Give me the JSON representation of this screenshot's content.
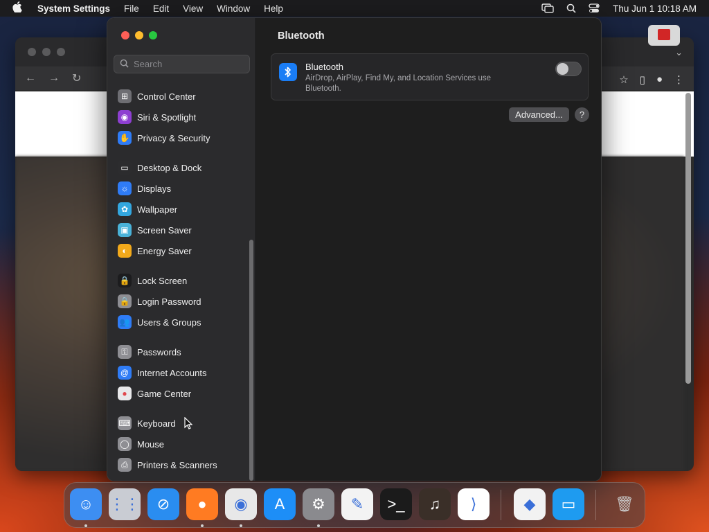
{
  "menubar": {
    "app_name": "System Settings",
    "menus": [
      "File",
      "Edit",
      "View",
      "Window",
      "Help"
    ],
    "clock": "Thu Jun 1  10:18 AM"
  },
  "window": {
    "search_placeholder": "Search",
    "sidebar_items": [
      {
        "label": "Control Center",
        "icon": "control-center-icon",
        "color": "#6e6e73"
      },
      {
        "label": "Siri & Spotlight",
        "icon": "siri-icon",
        "color": "#8e3fd1"
      },
      {
        "label": "Privacy & Security",
        "icon": "hand-icon",
        "color": "#2f7cf6"
      },
      {
        "label": "Desktop & Dock",
        "icon": "desktop-dock-icon",
        "color": "#2c2c2e"
      },
      {
        "label": "Displays",
        "icon": "sun-icon",
        "color": "#2f7cf6"
      },
      {
        "label": "Wallpaper",
        "icon": "flower-icon",
        "color": "#33a7e0"
      },
      {
        "label": "Screen Saver",
        "icon": "screensaver-icon",
        "color": "#4ab2d8"
      },
      {
        "label": "Energy Saver",
        "icon": "bulb-icon",
        "color": "#f2a91b"
      },
      {
        "label": "Lock Screen",
        "icon": "lock-icon",
        "color": "#1c1c1e"
      },
      {
        "label": "Login Password",
        "icon": "lock-small-icon",
        "color": "#8e8e93"
      },
      {
        "label": "Users & Groups",
        "icon": "users-icon",
        "color": "#2f7cf6"
      },
      {
        "label": "Passwords",
        "icon": "key-icon",
        "color": "#8e8e93"
      },
      {
        "label": "Internet Accounts",
        "icon": "at-icon",
        "color": "#2f7cf6"
      },
      {
        "label": "Game Center",
        "icon": "game-center-icon",
        "color": "#e8e8ea"
      },
      {
        "label": "Keyboard",
        "icon": "keyboard-icon",
        "color": "#8e8e93"
      },
      {
        "label": "Mouse",
        "icon": "mouse-icon",
        "color": "#8e8e93"
      },
      {
        "label": "Printers & Scanners",
        "icon": "printer-icon",
        "color": "#8e8e93"
      }
    ],
    "main": {
      "title": "Bluetooth",
      "card_title": "Bluetooth",
      "card_desc": "AirDrop, AirPlay, Find My, and Location Services use Bluetooth.",
      "toggle_state": "off",
      "advanced_label": "Advanced...",
      "help_label": "?"
    }
  },
  "dock": {
    "apps": [
      {
        "name": "finder-icon",
        "color": "#3d8ef2",
        "glyph": "☺",
        "running": true
      },
      {
        "name": "launchpad-icon",
        "color": "#c9ccd3",
        "glyph": "⋮⋮",
        "running": false
      },
      {
        "name": "safari-icon",
        "color": "#2a8df0",
        "glyph": "⊘",
        "running": false
      },
      {
        "name": "firefox-icon",
        "color": "#ff7b22",
        "glyph": "●",
        "running": true
      },
      {
        "name": "chrome-icon",
        "color": "#e8e8e8",
        "glyph": "◉",
        "running": true
      },
      {
        "name": "app-store-icon",
        "color": "#1d8ef7",
        "glyph": "A",
        "running": false
      },
      {
        "name": "system-settings-icon",
        "color": "#8a8a8e",
        "glyph": "⚙",
        "running": true
      },
      {
        "name": "textedit-icon",
        "color": "#f3f3f3",
        "glyph": "✎",
        "running": false
      },
      {
        "name": "terminal-icon",
        "color": "#1b1b1b",
        "glyph": ">_",
        "running": false
      },
      {
        "name": "garageband-icon",
        "color": "#3a2f28",
        "glyph": "♫",
        "running": false
      },
      {
        "name": "vscode-icon",
        "color": "#ffffff",
        "glyph": "⟩",
        "running": false
      },
      {
        "name": "visual-studio-icon",
        "color": "#f2f2f2",
        "glyph": "◆",
        "running": false
      },
      {
        "name": "keynote-icon",
        "color": "#1e9bf0",
        "glyph": "▭",
        "running": false
      },
      {
        "name": "trash-icon",
        "color": "#8c8c8c",
        "glyph": "🗑",
        "running": false
      }
    ]
  }
}
